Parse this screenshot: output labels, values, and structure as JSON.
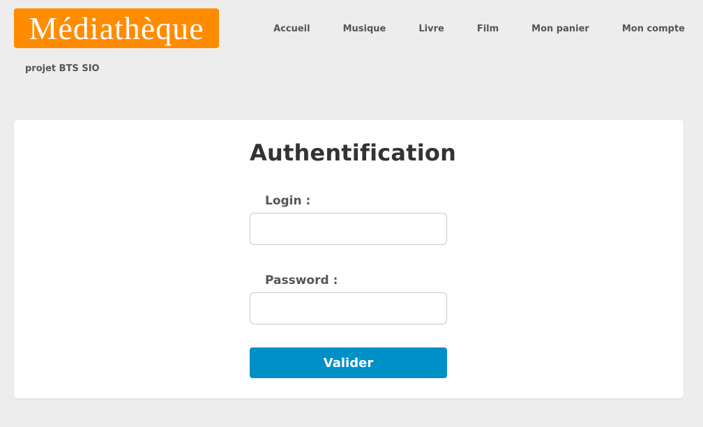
{
  "header": {
    "logo_text": "Médiathèque",
    "tagline": "projet BTS SIO"
  },
  "nav": {
    "items": [
      {
        "label": "Accueil"
      },
      {
        "label": "Musique"
      },
      {
        "label": "Livre"
      },
      {
        "label": "Film"
      },
      {
        "label": "Mon panier"
      },
      {
        "label": "Mon compte"
      }
    ]
  },
  "form": {
    "title": "Authentification",
    "login_label": "Login :",
    "login_value": "",
    "password_label": "Password :",
    "password_value": "",
    "submit_label": "Valider"
  },
  "colors": {
    "logo_bg": "#ff8c00",
    "button_bg": "#0090c8",
    "page_bg": "#ededed"
  }
}
